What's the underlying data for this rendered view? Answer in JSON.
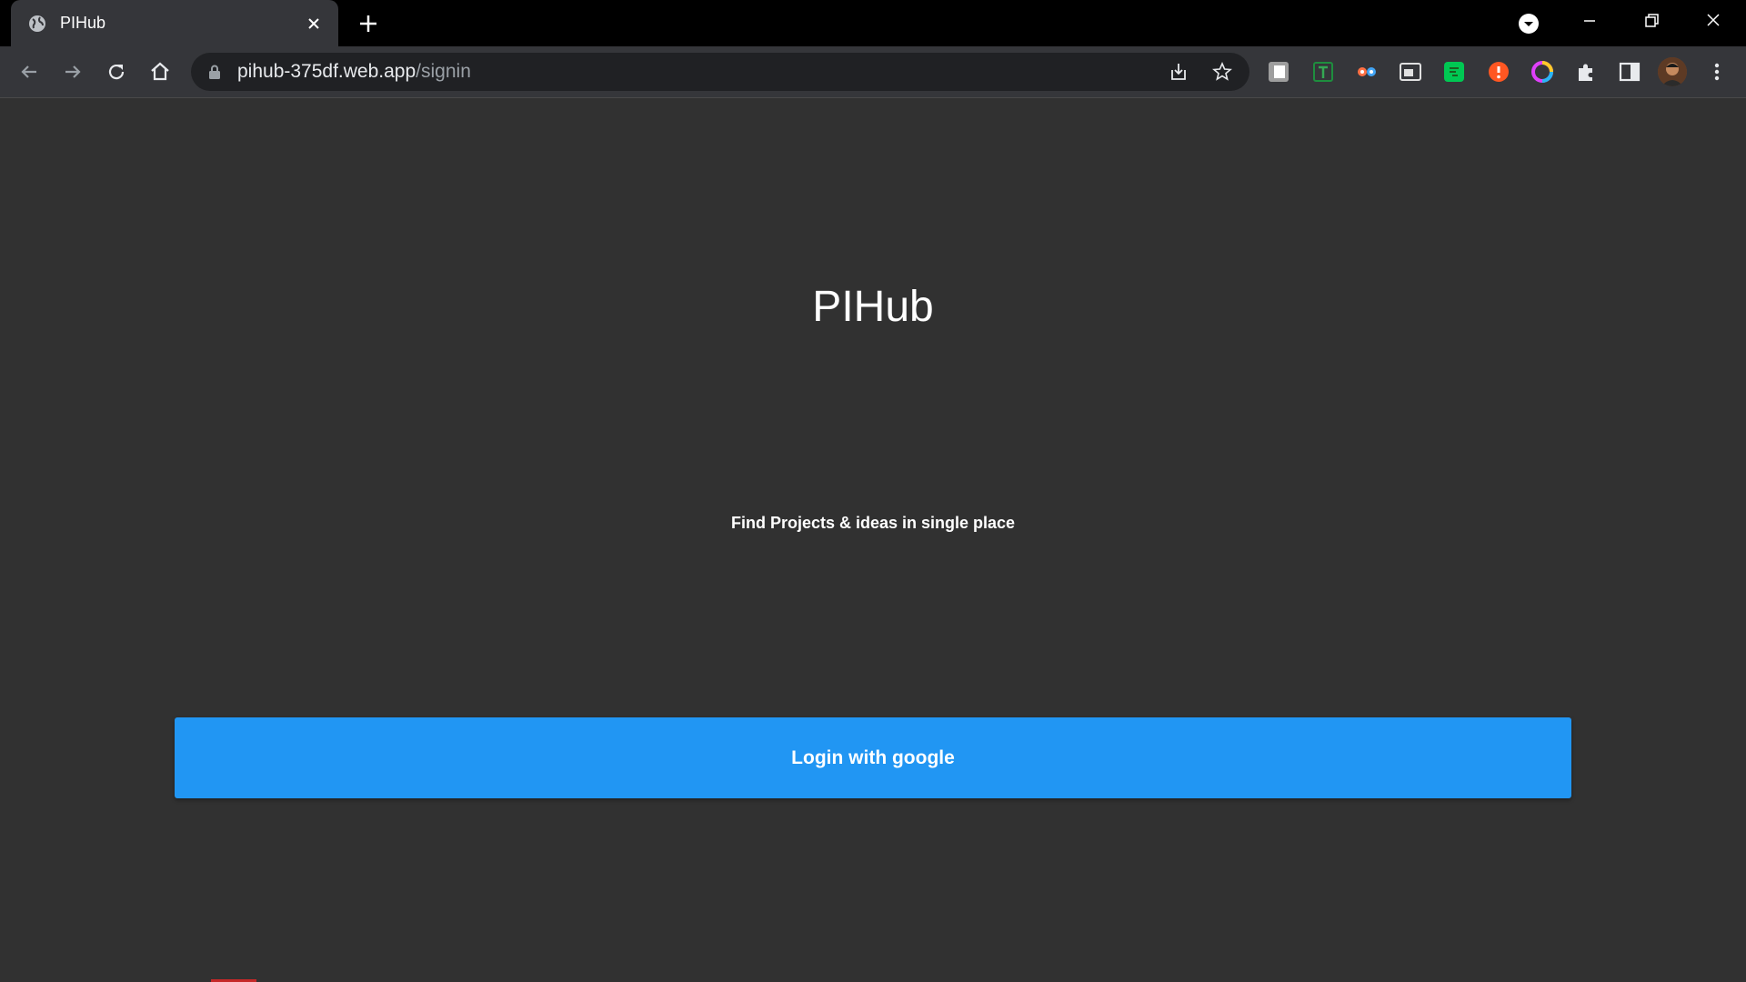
{
  "browser": {
    "tab": {
      "title": "PIHub",
      "favicon": "globe-icon"
    },
    "address_bar": {
      "domain": "pihub-375df.web.app",
      "path": "/signin"
    },
    "extensions": [
      {
        "name": "extension-grey-icon",
        "color": "#9e9e9e"
      },
      {
        "name": "extension-t-icon",
        "color": "#1e8e3e"
      },
      {
        "name": "extension-eyes-icon",
        "color": "#ff5722"
      },
      {
        "name": "extension-window-icon",
        "color": "#e0e0e0"
      },
      {
        "name": "extension-green-icon",
        "color": "#00c853"
      },
      {
        "name": "extension-alert-icon",
        "color": "#ff5722"
      },
      {
        "name": "extension-ring-icon",
        "color": "#e040fb"
      }
    ]
  },
  "page": {
    "title": "PIHub",
    "tagline": "Find Projects & ideas in single place",
    "login_button": {
      "label": "Login with google",
      "color": "#2196f3"
    }
  },
  "colors": {
    "page_background": "#313131",
    "toolbar": "#35363a",
    "tabstrip": "#000000"
  }
}
